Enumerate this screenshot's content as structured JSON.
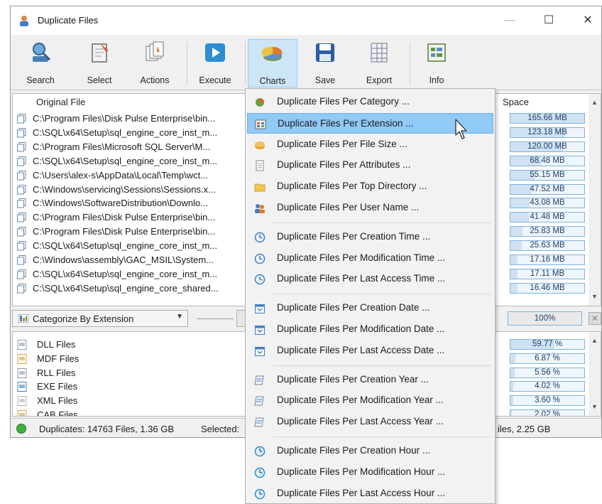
{
  "window": {
    "title": "Duplicate Files",
    "controls": {
      "minimize": "—",
      "maximize": "☐",
      "close": "✕"
    }
  },
  "toolbar": {
    "buttons": [
      {
        "label": "Search",
        "icon": "search-icon"
      },
      {
        "label": "Select",
        "icon": "select-icon"
      },
      {
        "label": "Actions",
        "icon": "actions-icon"
      },
      {
        "label": "Execute",
        "icon": "execute-icon"
      },
      {
        "label": "Charts",
        "icon": "charts-icon",
        "active": true
      },
      {
        "label": "Save",
        "icon": "save-icon"
      },
      {
        "label": "Export",
        "icon": "export-icon"
      },
      {
        "label": "Info",
        "icon": "info-icon"
      }
    ]
  },
  "files": {
    "columns": {
      "original_file": "Original File",
      "space": "Space"
    },
    "rows": [
      {
        "path": "C:\\Program Files\\Disk Pulse Enterprise\\bin...",
        "space": "165.66 MB",
        "fill": 1.0
      },
      {
        "path": "C:\\SQL\\x64\\Setup\\sql_engine_core_inst_m...",
        "space": "123.18 MB",
        "fill": 0.74
      },
      {
        "path": "C:\\Program Files\\Microsoft SQL Server\\M...",
        "space": "120.00 MB",
        "fill": 0.72
      },
      {
        "path": "C:\\SQL\\x64\\Setup\\sql_engine_core_inst_m...",
        "space": "68.48 MB",
        "fill": 0.41
      },
      {
        "path": "C:\\Users\\alex-s\\AppData\\Local\\Temp\\wct...",
        "space": "55.15 MB",
        "fill": 0.33
      },
      {
        "path": "C:\\Windows\\servicing\\Sessions\\Sessions.x...",
        "space": "47.52 MB",
        "fill": 0.29
      },
      {
        "path": "C:\\Windows\\SoftwareDistribution\\Downlo...",
        "space": "43.08 MB",
        "fill": 0.26
      },
      {
        "path": "C:\\Program Files\\Disk Pulse Enterprise\\bin...",
        "space": "41.48 MB",
        "fill": 0.25
      },
      {
        "path": "C:\\Program Files\\Disk Pulse Enterprise\\bin...",
        "space": "25.83 MB",
        "fill": 0.16
      },
      {
        "path": "C:\\SQL\\x64\\Setup\\sql_engine_core_inst_m...",
        "space": "25.63 MB",
        "fill": 0.15
      },
      {
        "path": "C:\\Windows\\assembly\\GAC_MSIL\\System...",
        "space": "17.16 MB",
        "fill": 0.1
      },
      {
        "path": "C:\\SQL\\x64\\Setup\\sql_engine_core_inst_m...",
        "space": "17.11 MB",
        "fill": 0.1
      },
      {
        "path": "C:\\SQL\\x64\\Setup\\sql_engine_core_shared...",
        "space": "16.46 MB",
        "fill": 0.1
      }
    ]
  },
  "categorize": {
    "selected": "Categorize By Extension",
    "total_percent": "100%"
  },
  "categories": [
    {
      "name": "DLL Files",
      "percent": "59.77 %",
      "fill": 0.5977,
      "icon": "dll-icon"
    },
    {
      "name": "MDF Files",
      "percent": "6.87 %",
      "fill": 0.0687,
      "icon": "mdf-icon"
    },
    {
      "name": "RLL Files",
      "percent": "5.56 %",
      "fill": 0.0556,
      "icon": "rll-icon"
    },
    {
      "name": "EXE Files",
      "percent": "4.02 %",
      "fill": 0.0402,
      "icon": "exe-icon"
    },
    {
      "name": "XML Files",
      "percent": "3.60 %",
      "fill": 0.036,
      "icon": "xml-icon"
    },
    {
      "name": "CAB Files",
      "percent": "2.02 %",
      "fill": 0.0202,
      "icon": "cab-icon"
    }
  ],
  "status": {
    "duplicates": "Duplicates: 14763 Files, 1.36 GB",
    "selected": "Selected:",
    "total_tail": "iles, 2.25 GB"
  },
  "charts_menu": {
    "items": [
      {
        "label": "Duplicate Files Per Category ...",
        "icon": "pie-chart-icon"
      },
      {
        "label": "Duplicate Files Per Extension ...",
        "icon": "extension-icon",
        "highlighted": true
      },
      {
        "label": "Duplicate Files Per File Size ...",
        "icon": "file-size-icon"
      },
      {
        "label": "Duplicate Files Per Attributes ...",
        "icon": "attributes-icon"
      },
      {
        "label": "Duplicate Files Per Top Directory ...",
        "icon": "folder-icon"
      },
      {
        "label": "Duplicate Files Per User Name ...",
        "icon": "users-icon"
      },
      {
        "label": "Duplicate Files Per Creation Time ...",
        "icon": "clock-icon"
      },
      {
        "label": "Duplicate Files Per Modification Time ...",
        "icon": "clock-icon"
      },
      {
        "label": "Duplicate Files Per Last Access Time ...",
        "icon": "clock-icon"
      },
      {
        "label": "Duplicate Files Per Creation Date ...",
        "icon": "calendar-icon"
      },
      {
        "label": "Duplicate Files Per Modification Date ...",
        "icon": "calendar-icon"
      },
      {
        "label": "Duplicate Files Per Last Access Date ...",
        "icon": "calendar-icon"
      },
      {
        "label": "Duplicate Files Per Creation Year ...",
        "icon": "year-icon"
      },
      {
        "label": "Duplicate Files Per Modification Year ...",
        "icon": "year-icon"
      },
      {
        "label": "Duplicate Files Per Last Access Year ...",
        "icon": "year-icon"
      },
      {
        "label": "Duplicate Files Per Creation Hour ...",
        "icon": "hour-icon"
      },
      {
        "label": "Duplicate Files Per Modification Hour ...",
        "icon": "hour-icon"
      },
      {
        "label": "Duplicate Files Per Last Access Hour ...",
        "icon": "hour-icon"
      }
    ]
  },
  "colors": {
    "accent": "#91c9f7",
    "bar_border": "#7fb2dd",
    "bar_fill": "#cfe2f4",
    "status_ok": "#3cb043"
  }
}
